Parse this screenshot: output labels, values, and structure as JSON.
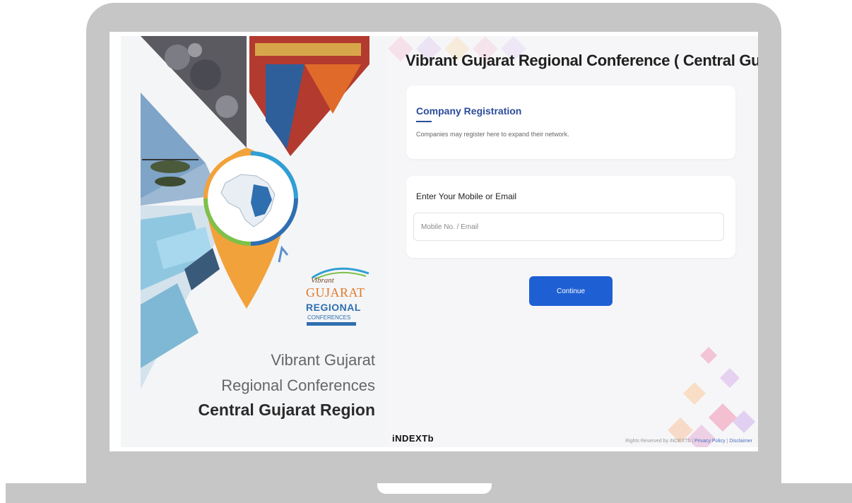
{
  "left_panel": {
    "title_line1": "Vibrant Gujarat",
    "title_line2": "Regional Conferences",
    "title_line3": "Central Gujarat Region",
    "logo": {
      "vibrant": "Vibrant",
      "gujarat": "GUJARAT",
      "regional": "REGIONAL",
      "conferences": "CONFERENCES"
    }
  },
  "main": {
    "title": "Vibrant Gujarat Regional Conference ( Central Gujarat )",
    "registration_card": {
      "title": "Company Registration",
      "description": "Companies may register here to expand their network."
    },
    "login_card": {
      "label": "Enter Your Mobile or Email",
      "input_placeholder": "Mobile No. / Email",
      "input_value": ""
    },
    "continue_label": "Continue"
  },
  "footer": {
    "brand": "iNDEXTb",
    "rights_text": "Rights Reserved by iNDEXTb",
    "separator": "|",
    "privacy_label": "Privacy Policy",
    "disclaimer_label": "Disclaimer"
  },
  "colors": {
    "primary": "#1f5fd4",
    "heading_blue": "#2b4c9a",
    "laptop_frame": "#c6c6c6"
  }
}
